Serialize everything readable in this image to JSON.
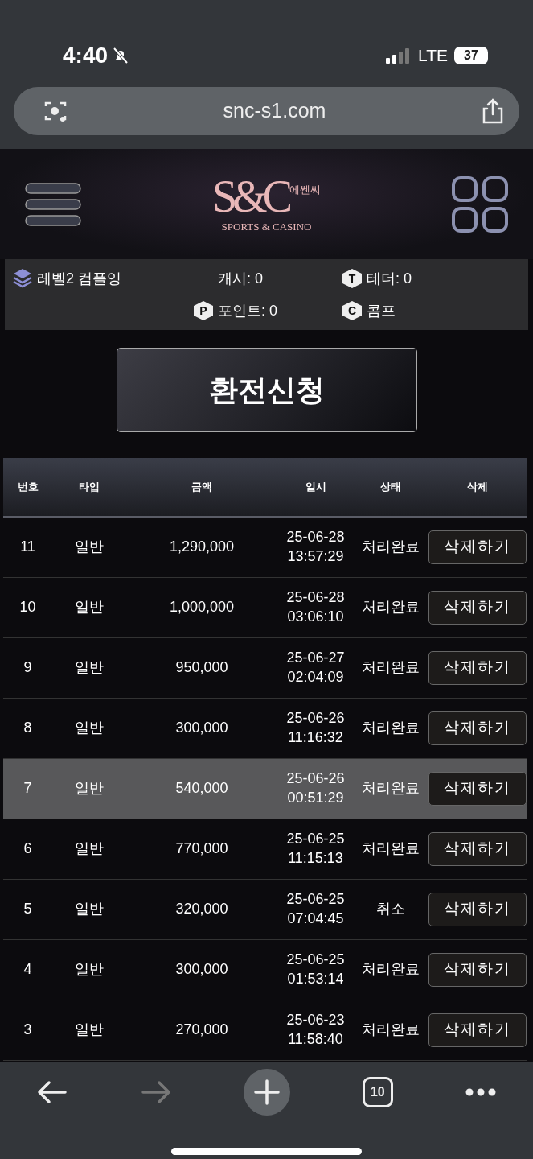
{
  "status_bar": {
    "time": "4:40",
    "network": "LTE",
    "battery": "37"
  },
  "address_bar": {
    "url": "snc-s1.com"
  },
  "logo": {
    "mark": "S&C",
    "korean": "에쎈씨",
    "tagline": "SPORTS & CASINO"
  },
  "info": [
    {
      "kind": "level",
      "text": "레벨2 컴플잉"
    },
    {
      "kind": "plain",
      "text": "캐시: 0"
    },
    {
      "kind": "badge",
      "badge": "T",
      "text": "테더: 0"
    },
    {
      "kind": "empty"
    },
    {
      "kind": "badge",
      "badge": "P",
      "text": "포인트: 0"
    },
    {
      "kind": "badge",
      "badge": "C",
      "text": "콤프"
    }
  ],
  "exchange_button": "환전신청",
  "table": {
    "columns": [
      "번호",
      "타입",
      "금액",
      "일시",
      "상태",
      "삭제"
    ],
    "rows": [
      {
        "no": "11",
        "type": "일반",
        "amount": "1,290,000",
        "date": "25-06-28",
        "time": "13:57:29",
        "status": "처리완료",
        "action": "삭제하기",
        "selected": false
      },
      {
        "no": "10",
        "type": "일반",
        "amount": "1,000,000",
        "date": "25-06-28",
        "time": "03:06:10",
        "status": "처리완료",
        "action": "삭제하기",
        "selected": false
      },
      {
        "no": "9",
        "type": "일반",
        "amount": "950,000",
        "date": "25-06-27",
        "time": "02:04:09",
        "status": "처리완료",
        "action": "삭제하기",
        "selected": false
      },
      {
        "no": "8",
        "type": "일반",
        "amount": "300,000",
        "date": "25-06-26",
        "time": "11:16:32",
        "status": "처리완료",
        "action": "삭제하기",
        "selected": false
      },
      {
        "no": "7",
        "type": "일반",
        "amount": "540,000",
        "date": "25-06-26",
        "time": "00:51:29",
        "status": "처리완료",
        "action": "삭제하기",
        "selected": true
      },
      {
        "no": "6",
        "type": "일반",
        "amount": "770,000",
        "date": "25-06-25",
        "time": "11:15:13",
        "status": "처리완료",
        "action": "삭제하기",
        "selected": false
      },
      {
        "no": "5",
        "type": "일반",
        "amount": "320,000",
        "date": "25-06-25",
        "time": "07:04:45",
        "status": "취소",
        "action": "삭제하기",
        "selected": false
      },
      {
        "no": "4",
        "type": "일반",
        "amount": "300,000",
        "date": "25-06-25",
        "time": "01:53:14",
        "status": "처리완료",
        "action": "삭제하기",
        "selected": false
      },
      {
        "no": "3",
        "type": "일반",
        "amount": "270,000",
        "date": "25-06-23",
        "time": "11:58:40",
        "status": "처리완료",
        "action": "삭제하기",
        "selected": false
      }
    ]
  },
  "toolbar": {
    "back_disabled": false,
    "forward_disabled": true,
    "tab_count": "10"
  }
}
